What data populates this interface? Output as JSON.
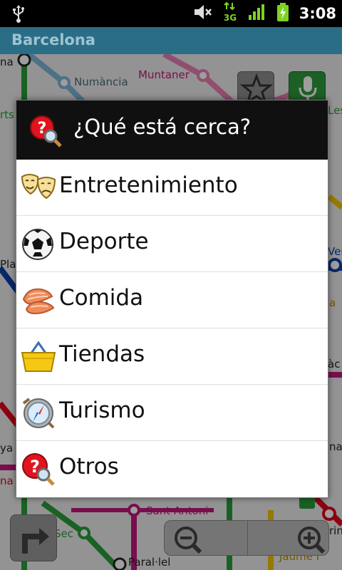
{
  "statusbar": {
    "time": "3:08",
    "network": "3G",
    "icons": [
      "usb-icon",
      "mute-icon",
      "network-3g-icon",
      "signal-icon",
      "battery-charging-icon"
    ]
  },
  "app": {
    "title": "Barcelona"
  },
  "map": {
    "stations": {
      "numancia": "Numància",
      "muntaner": "Muntaner",
      "sant_antoni": "Sant Antoni",
      "paral_lel": "Paral·lel",
      "sec": "Sec",
      "jaume_i": "Jaume I",
      "left_rts": "rts",
      "left_plag": "Plag",
      "left_ya": "ya",
      "left_na": "na",
      "right_les": "Les",
      "right_ver": "Ver",
      "right_a": "a",
      "right_ac": "àc",
      "right_na": "na",
      "right_rin": "rin"
    },
    "line_colors": {
      "purple": "#c2187c",
      "red": "#e2001a",
      "green": "#2a9d3a",
      "yellow": "#f5c400",
      "blue": "#0b3fa8",
      "lightblue": "#7eb6d8",
      "pink": "#e87fb5"
    }
  },
  "dialog": {
    "title": "¿Qué está cerca?",
    "items": [
      {
        "label": "Entretenimiento",
        "icon": "theater-masks-icon"
      },
      {
        "label": "Deporte",
        "icon": "soccer-ball-icon"
      },
      {
        "label": "Comida",
        "icon": "salmon-food-icon"
      },
      {
        "label": "Tiendas",
        "icon": "shopping-basket-icon"
      },
      {
        "label": "Turismo",
        "icon": "compass-icon"
      },
      {
        "label": "Otros",
        "icon": "question-magnifier-icon"
      }
    ]
  }
}
